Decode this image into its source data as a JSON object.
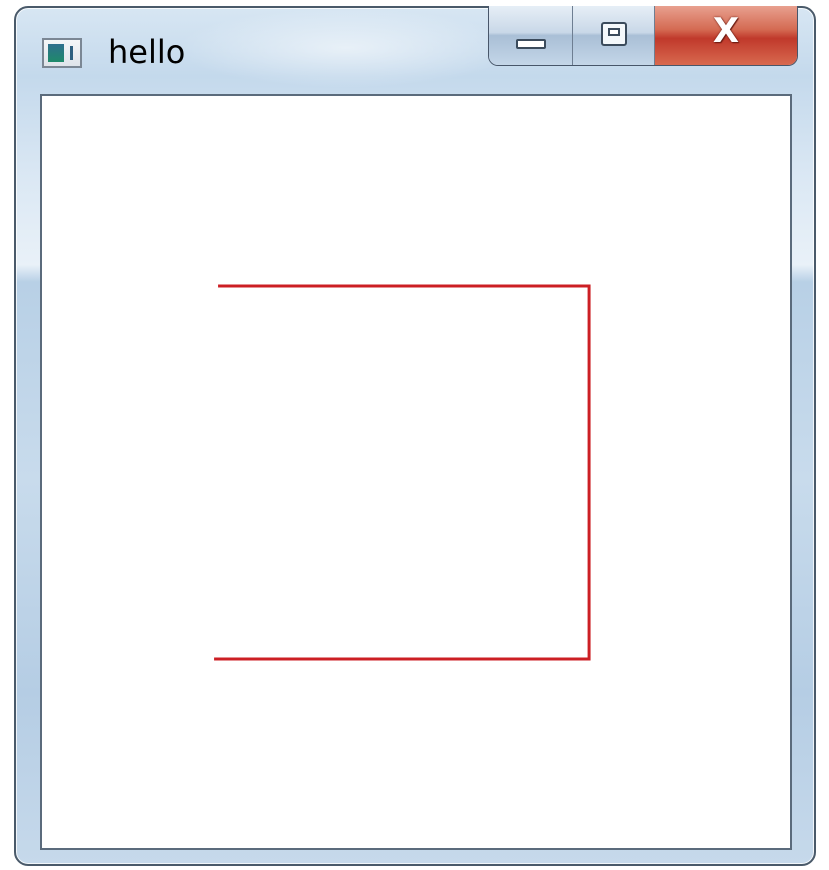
{
  "window": {
    "title": "hello",
    "app_icon": "console-app-icon"
  },
  "caption_buttons": {
    "minimize_icon": "minimize-icon",
    "maximize_icon": "maximize-icon",
    "close_label": "X"
  },
  "canvas": {
    "background": "#ffffff",
    "line_color": "#cc1f24",
    "shape": "open-bracket-line-path"
  }
}
